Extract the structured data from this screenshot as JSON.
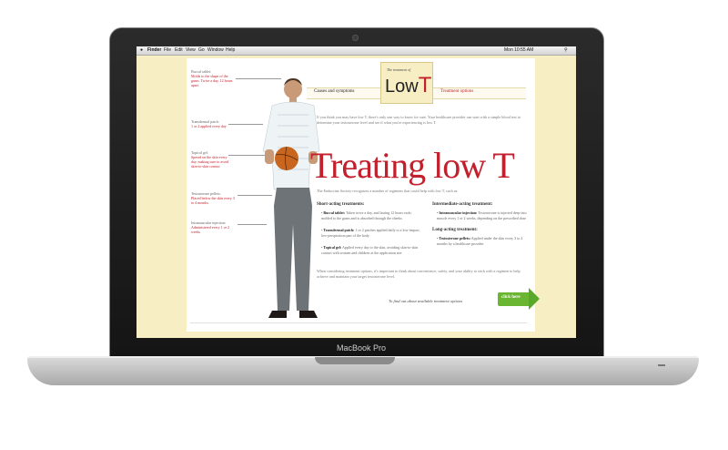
{
  "device": {
    "label": "MacBook Pro"
  },
  "menubar": {
    "apple": "",
    "items": [
      "Finder",
      "File",
      "Edit",
      "View",
      "Go",
      "Window",
      "Help"
    ],
    "clock": "Mon 10:55 AM"
  },
  "header": {
    "logo_small": "The treatment of",
    "logo_low": "Low",
    "logo_t": "T",
    "nav_left": "Causes and symptoms",
    "nav_right": "Treatment options"
  },
  "callouts": [
    {
      "title": "Buccal tablet:",
      "detail": "Molds to the shape of the gums. Twice a day, 12 hours apart."
    },
    {
      "title": "Transdermal patch:",
      "detail": "1 or 2 applied every day"
    },
    {
      "title": "Topical gel:",
      "detail": "Spread on the skin every day, making sure to avoid skin-to-skin contact"
    },
    {
      "title": "Testosterone pellets:",
      "detail": "Placed below the skin every 3 to 4 months"
    },
    {
      "title": "Intramuscular injection:",
      "detail": "Administered every 1 or 2 weeks"
    }
  ],
  "intro": "If you think you may have low T, there's only one way to know for sure. Your healthcare provider can start with a simple blood test to determine your testosterone level and see if what you're experiencing is low T.",
  "headline": "Treating low T",
  "society": "The Endocrine Society recognizes a number of regimens that could help with low T, such as:",
  "short_title": "Short-acting treatments:",
  "short_items": [
    {
      "name": "Buccal tablet:",
      "text": "Taken twice a day, and lasting 12 hours each; molded to the gums and is absorbed through the cheeks"
    },
    {
      "name": "Transdermal patch:",
      "text": "1 or 2 patches applied daily to a low-impact, low-perspiration part of the body"
    },
    {
      "name": "Topical gel:",
      "text": "Applied every day to the skin, avoiding skin-to-skin contact with women and children at the application site"
    }
  ],
  "inter_title": "Intermediate-acting treatment:",
  "inter_items": [
    {
      "name": "Intramuscular injection:",
      "text": "Testosterone is injected deep into muscle every 1 or 2 weeks, depending on the prescribed dose"
    }
  ],
  "long_title": "Long-acting treatment:",
  "long_items": [
    {
      "name": "Testosterone pellets:",
      "text": "Applied under the skin every 3 to 4 months by a healthcare provider"
    }
  ],
  "closing": "When considering treatment options, it's important to think about convenience, safety, and your ability to stick with a regimen to help achieve and maintain your target testosterone level.",
  "find_out": "To find out about available treatment options",
  "click_here": "click here",
  "colors": {
    "accent": "#c2202c",
    "button": "#6ab531",
    "panel": "#f7eec3"
  }
}
